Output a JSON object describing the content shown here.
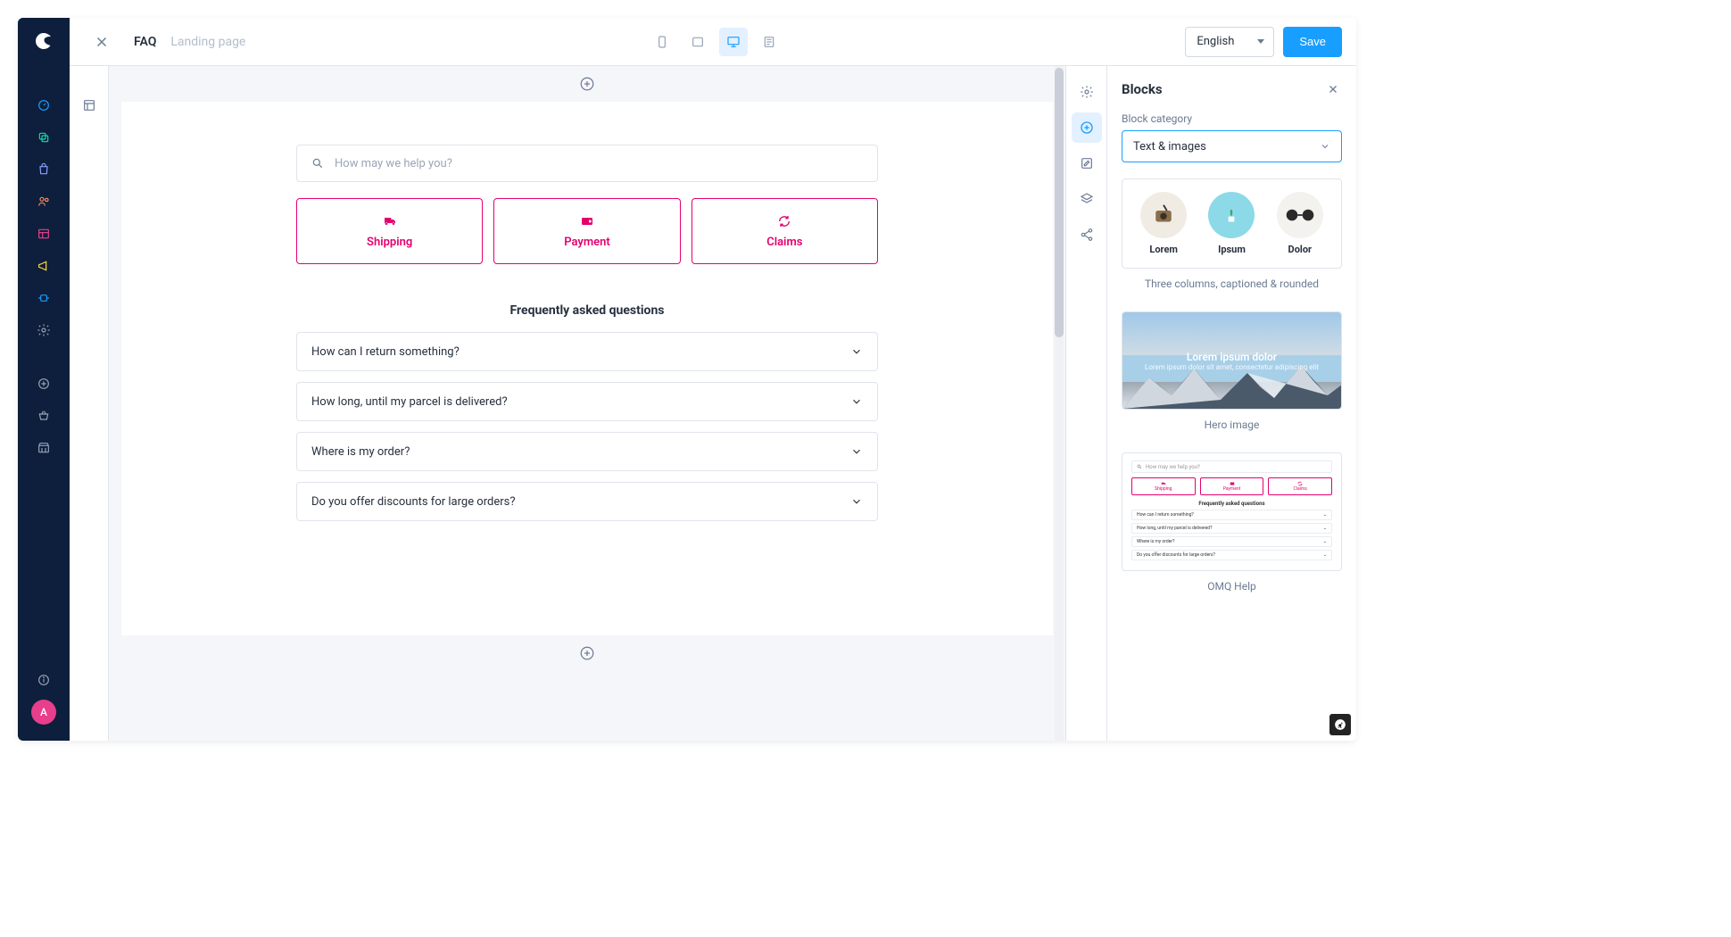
{
  "topbar": {
    "page_title": "FAQ",
    "page_type": "Landing page",
    "language": "English",
    "save_label": "Save"
  },
  "canvas": {
    "search_placeholder": "How may we help you?",
    "topics": [
      {
        "label": "Shipping"
      },
      {
        "label": "Payment"
      },
      {
        "label": "Claims"
      }
    ],
    "faq_heading": "Frequently asked questions",
    "faqs": [
      "How can I return something?",
      "How long, until my parcel is delivered?",
      "Where is my order?",
      "Do you offer discounts for large orders?"
    ]
  },
  "panel": {
    "title": "Blocks",
    "category_label": "Block category",
    "category_value": "Text & images",
    "block1": {
      "columns": [
        "Lorem",
        "Ipsum",
        "Dolor"
      ],
      "caption": "Three columns, captioned & rounded"
    },
    "block2": {
      "title": "Lorem ipsum dolor",
      "sub": "Lorem ipsum dolor sit amet, consectetur adipiscing elit",
      "caption": "Hero image"
    },
    "block3": {
      "search_placeholder": "How may we help you?",
      "topics": [
        "Shipping",
        "Payment",
        "Claims"
      ],
      "heading": "Frequently asked questions",
      "faqs": [
        "How can I return something?",
        "How long, until my parcel is delivered?",
        "Where is my order?",
        "Do you offer discounts for large orders?"
      ],
      "caption": "OMQ Help"
    }
  },
  "avatar_initial": "A"
}
